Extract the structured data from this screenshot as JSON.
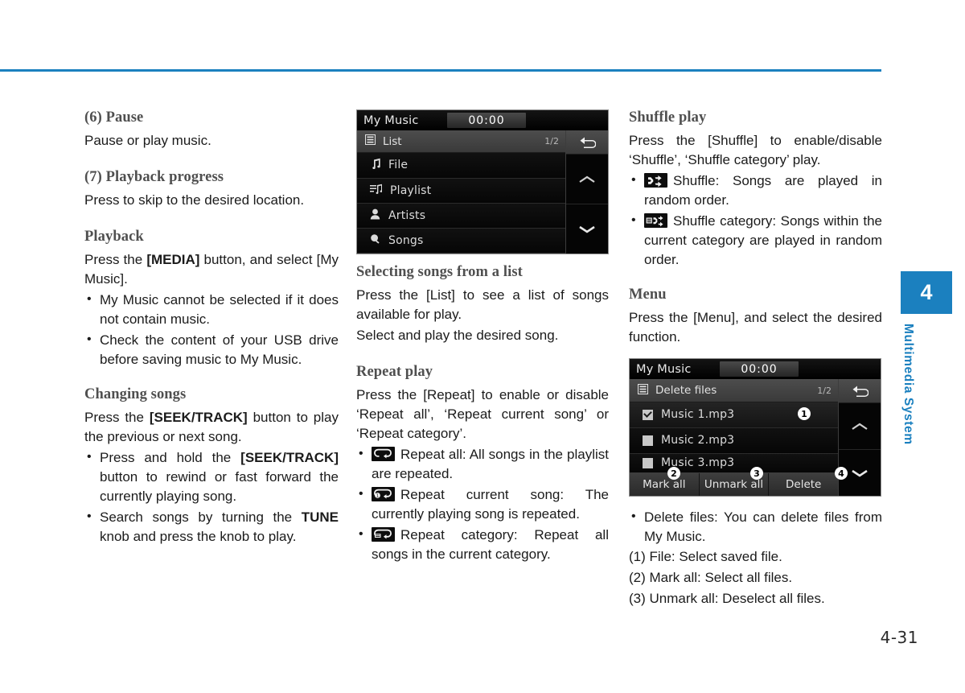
{
  "page": {
    "number": "4-31",
    "accent_color": "#1b80bf"
  },
  "side_tab": {
    "chapter": "4",
    "label": "Multimedia System"
  },
  "col1": {
    "s1_heading": "(6) Pause",
    "s1_body": "Pause or play music.",
    "s2_heading": "(7) Playback progress",
    "s2_body": "Press to skip to the desired location.",
    "s3_heading": "Playback",
    "s3_body_a": "Press the ",
    "s3_body_b": "[MEDIA]",
    "s3_body_c": " button, and select [My Music].",
    "s3_bullets": [
      "My Music cannot be selected if it does not contain music.",
      "Check the content of your USB drive before saving music to My Music."
    ],
    "s4_heading": "Changing songs",
    "s4_body_a": "Press the ",
    "s4_body_b": "[SEEK/TRACK]",
    "s4_body_c": " button to play the previous or next song.",
    "s4_b1_a": "Press and hold the ",
    "s4_b1_b": "[SEEK/TRACK]",
    "s4_b1_c": " button to rewind or fast forward the currently playing song.",
    "s4_b2_a": "Search songs by turning the ",
    "s4_b2_b": "TUNE",
    "s4_b2_c": " knob and press the knob to play."
  },
  "screen1": {
    "title": "My Music",
    "time": "00:00",
    "header_label": "List",
    "header_page": "1/2",
    "back_icon": "return-arrow-icon",
    "up_icon": "chevron-up-icon",
    "down_icon": "chevron-down-icon",
    "rows": [
      {
        "label": "File",
        "icon": "music-note-icon"
      },
      {
        "label": "Playlist",
        "icon": "playlist-icon"
      },
      {
        "label": "Artists",
        "icon": "person-icon"
      },
      {
        "label": "Songs",
        "icon": "song-search-icon"
      }
    ]
  },
  "col2": {
    "s1_heading": "Selecting songs from a list",
    "s1_body_1": "Press the [List] to see a list of songs available for play.",
    "s1_body_2": "Select and play the desired song.",
    "s2_heading": "Repeat play",
    "s2_body": "Press the [Repeat] to enable or disable ‘Repeat all’, ‘Repeat current song’ or ‘Repeat category’.",
    "s2_bullets": [
      {
        "icon": "repeat-all-icon",
        "text": "Repeat all: All songs in the playlist are repeated."
      },
      {
        "icon": "repeat-one-icon",
        "text": "Repeat current song: The currently playing song is repeated."
      },
      {
        "icon": "repeat-category-icon",
        "text": "Repeat category: Repeat all songs in the current category."
      }
    ]
  },
  "col3": {
    "s1_heading": "Shuffle play",
    "s1_body": "Press the [Shuffle] to enable/disable ‘Shuffle’, ‘Shuffle category’ play.",
    "s1_bullets": [
      {
        "icon": "shuffle-icon",
        "text": "Shuffle: Songs are played in random order."
      },
      {
        "icon": "shuffle-category-icon",
        "text": "Shuffle category: Songs within the current category are played in random order."
      }
    ],
    "s2_heading": "Menu",
    "s2_body": "Press the [Menu], and select the desired function.",
    "s3_bullet": "Delete files: You can delete files from My Music.",
    "s3_numbered": [
      "(1) File: Select saved file.",
      "(2) Mark all: Select all files.",
      "(3) Unmark all: Deselect all files."
    ]
  },
  "screen2": {
    "title": "My Music",
    "time": "00:00",
    "header_label": "Delete files",
    "header_page": "1/2",
    "back_icon": "return-arrow-icon",
    "up_icon": "chevron-up-icon",
    "down_icon": "chevron-down-icon",
    "rows": [
      {
        "label": "Music 1.mp3",
        "checked": true
      },
      {
        "label": "Music 2.mp3",
        "checked": false
      },
      {
        "label": "Music 3.mp3",
        "checked": false
      }
    ],
    "buttons": [
      "Mark all",
      "Unmark all",
      "Delete"
    ],
    "callouts": [
      "1",
      "2",
      "3",
      "4"
    ]
  }
}
